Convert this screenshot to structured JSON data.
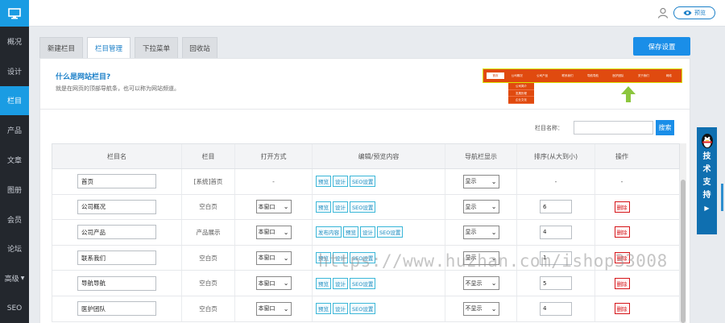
{
  "sidebar": {
    "items": [
      {
        "label": "概况",
        "active": false
      },
      {
        "label": "设计",
        "active": false
      },
      {
        "label": "栏目",
        "active": true
      },
      {
        "label": "产品",
        "active": false
      },
      {
        "label": "文章",
        "active": false
      },
      {
        "label": "图册",
        "active": false
      },
      {
        "label": "会员",
        "active": false
      },
      {
        "label": "论坛",
        "active": false
      },
      {
        "label": "高级",
        "active": false
      },
      {
        "label": "SEO",
        "active": false
      }
    ]
  },
  "topbar": {
    "preview_label": "预览"
  },
  "tabs": [
    {
      "label": "新建栏目"
    },
    {
      "label": "栏目管理"
    },
    {
      "label": "下拉菜单"
    },
    {
      "label": "回收站"
    }
  ],
  "save_label": "保存设置",
  "info": {
    "title": "什么是网站栏目?",
    "desc": "就是在网页的顶部导航条，也可以称为网站频道。"
  },
  "illustration": {
    "nav": [
      "首页",
      "公司概况",
      "公司产品",
      "联系我们",
      "导航导航",
      "医护团队",
      "关于我们",
      "网络"
    ],
    "dropdown": [
      "公司简介",
      "发展历程",
      "企业文化"
    ]
  },
  "search": {
    "label": "栏目名称：",
    "button": "搜索",
    "placeholder": ""
  },
  "table": {
    "headers": [
      "栏目名",
      "栏目",
      "打开方式",
      "编辑/预览内容",
      "导航栏显示",
      "排序(从大到小)",
      "操作"
    ],
    "rows": [
      {
        "name": "首页",
        "type": "[系统]首页",
        "open": "-",
        "buttons": [
          "预览",
          "设计",
          "SEO设置"
        ],
        "nav": "显示",
        "sort": "-",
        "op": "-"
      },
      {
        "name": "公司概况",
        "type": "空白页",
        "open": "本窗口",
        "buttons": [
          "预览",
          "设计",
          "SEO设置"
        ],
        "nav": "显示",
        "sort": "6",
        "op": "删除"
      },
      {
        "name": "公司产品",
        "type": "产品展示",
        "open": "本窗口",
        "buttons": [
          "发布内容",
          "预览",
          "设计",
          "SEO设置"
        ],
        "nav": "显示",
        "sort": "4",
        "op": "删除"
      },
      {
        "name": "联系我们",
        "type": "空白页",
        "open": "本窗口",
        "buttons": [
          "预览",
          "设计",
          "SEO设置"
        ],
        "nav": "显示",
        "sort": "1",
        "op": "删除"
      },
      {
        "name": "导航导航",
        "type": "空白页",
        "open": "本窗口",
        "buttons": [
          "预览",
          "设计",
          "SEO设置"
        ],
        "nav": "不显示",
        "sort": "5",
        "op": "删除"
      },
      {
        "name": "医护团队",
        "type": "空白页",
        "open": "本窗口",
        "buttons": [
          "预览",
          "设计",
          "SEO设置"
        ],
        "nav": "不显示",
        "sort": "4",
        "op": "删除"
      }
    ]
  },
  "support": {
    "label": "技术支持"
  },
  "watermark": "https://www.huzhan.com/ishop33008",
  "colors": {
    "accent": "#1a9ce3",
    "sidebar": "#23272d",
    "danger": "#d5161a"
  }
}
